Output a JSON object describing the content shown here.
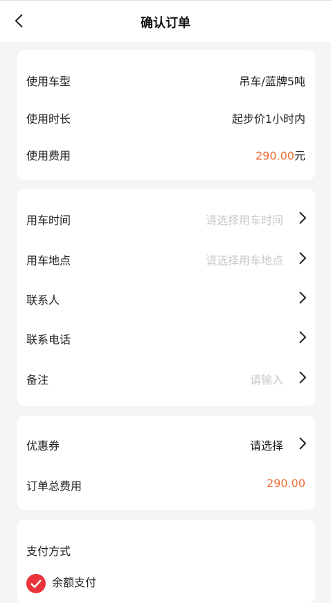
{
  "header": {
    "title": "确认订单"
  },
  "vehicle_card": {
    "rows": [
      {
        "label": "使用车型",
        "value": "吊车/蓝牌5吨"
      },
      {
        "label": "使用时长",
        "value": "起步价1小时内"
      },
      {
        "label": "使用费用",
        "amount": "290.00",
        "unit": "元"
      }
    ]
  },
  "booking_card": {
    "rows": [
      {
        "label": "用车时间",
        "placeholder": "请选择用车时间"
      },
      {
        "label": "用车地点",
        "placeholder": "请选择用车地点"
      },
      {
        "label": "联系人",
        "placeholder": ""
      },
      {
        "label": "联系电话",
        "placeholder": ""
      },
      {
        "label": "备注",
        "placeholder": "请输入"
      }
    ]
  },
  "coupon_card": {
    "coupon_label": "优惠券",
    "coupon_value": "请选择",
    "total_label": "订单总费用",
    "total_value": "290.00"
  },
  "payment_card": {
    "title": "支付方式",
    "option_label": "余额支付"
  },
  "colors": {
    "accent": "#f06d36",
    "check": "#e8333a",
    "placeholder": "#c8c8c8"
  },
  "icons": {
    "back": "chevron-left-icon",
    "row_arrow": "chevron-right-icon",
    "selected": "check-circle-icon"
  }
}
